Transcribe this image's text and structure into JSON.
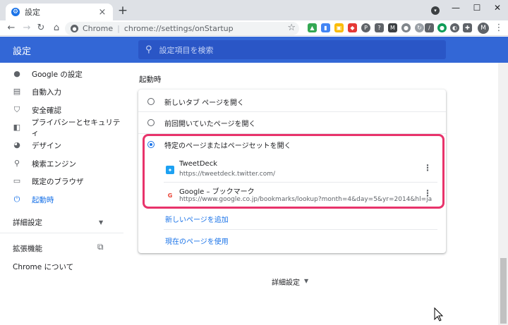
{
  "browser": {
    "tab_title": "設定",
    "tab_close": "×",
    "new_tab": "+",
    "window_controls": {
      "minimize": "—",
      "maximize": "☐",
      "close": "✕"
    },
    "toolbar": {
      "back": "←",
      "forward": "→",
      "reload": "↻",
      "home": "⌂"
    },
    "omnibox": {
      "host": "Chrome",
      "url": "chrome://settings/onStartup",
      "star": "☆"
    },
    "profile_initial": "M",
    "extension_icons": [
      "drive-icon",
      "bookmark-icon",
      "lock-icon",
      "pocket-icon",
      "pinterest-icon",
      "help-icon",
      "m-icon",
      "github-icon",
      "sync-icon",
      "slash-icon",
      "green-icon",
      "translate-icon",
      "puzzle-icon"
    ]
  },
  "header": {
    "title": "設定",
    "search_placeholder": "設定項目を検索"
  },
  "sidebar": {
    "items": [
      {
        "label": "Google の設定",
        "icon": "person-icon"
      },
      {
        "label": "自動入力",
        "icon": "clipboard-icon"
      },
      {
        "label": "安全確認",
        "icon": "shield-check-icon"
      },
      {
        "label": "プライバシーとセキュリティ",
        "icon": "shield-icon"
      },
      {
        "label": "デザイン",
        "icon": "palette-icon"
      },
      {
        "label": "検索エンジン",
        "icon": "search-icon"
      },
      {
        "label": "既定のブラウザ",
        "icon": "browser-icon"
      },
      {
        "label": "起動時",
        "icon": "power-icon",
        "active": true
      }
    ],
    "advanced": "詳細設定",
    "extensions": "拡張機能",
    "about": "Chrome について"
  },
  "main": {
    "section_title": "起動時",
    "options": [
      {
        "label": "新しいタブ ページを開く",
        "checked": false
      },
      {
        "label": "前回開いていたページを開く",
        "checked": false
      },
      {
        "label": "特定のページまたはページセットを開く",
        "checked": true
      }
    ],
    "pages": [
      {
        "name": "TweetDeck",
        "url": "https://tweetdeck.twitter.com/",
        "icon": "twitter-icon"
      },
      {
        "name": "Google – ブックマーク",
        "url": "https://www.google.co.jp/bookmarks/lookup?month=4&day=5&yr=2014&hl=ja",
        "icon": "google-icon"
      }
    ],
    "more_glyph": "⋮",
    "add_page": "新しいページを追加",
    "use_current": "現在のページを使用",
    "advanced": "詳細設定"
  },
  "colors": {
    "accent": "#1a73e8",
    "header": "#3367d6",
    "highlight": "#e8336b"
  }
}
